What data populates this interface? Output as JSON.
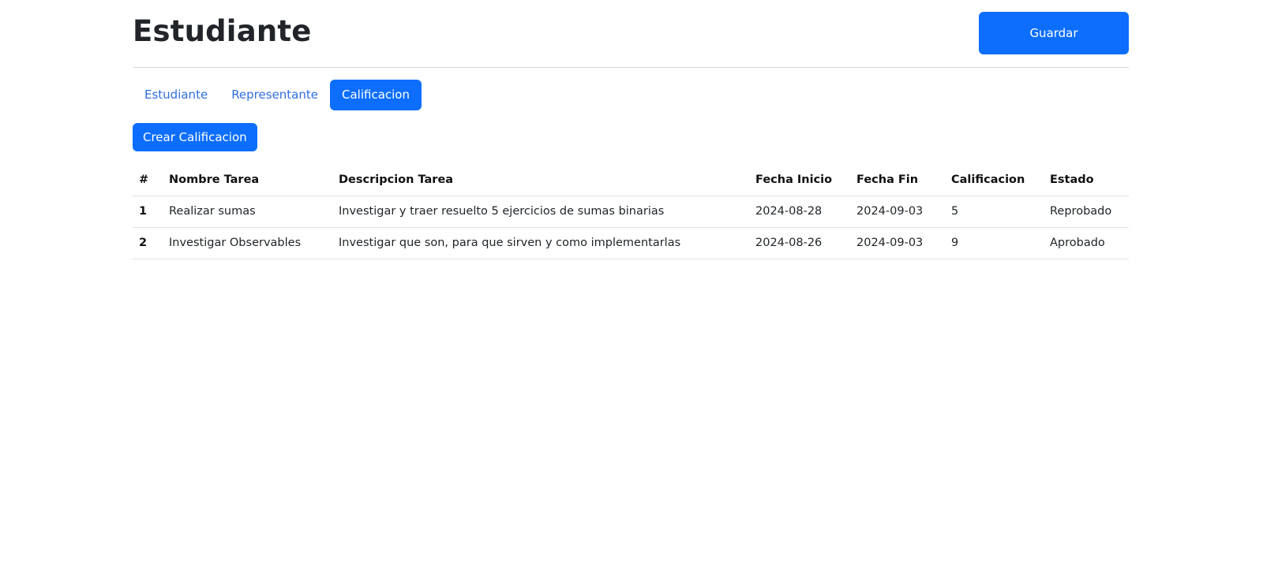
{
  "header": {
    "title": "Estudiante",
    "save_label": "Guardar"
  },
  "tabs": [
    {
      "label": "Estudiante",
      "active": false
    },
    {
      "label": "Representante",
      "active": false
    },
    {
      "label": "Calificacion",
      "active": true
    }
  ],
  "actions": {
    "create_label": "Crear Calificacion"
  },
  "table": {
    "columns": [
      "#",
      "Nombre Tarea",
      "Descripcion Tarea",
      "Fecha Inicio",
      "Fecha Fin",
      "Calificacion",
      "Estado"
    ],
    "rows": [
      [
        "1",
        "Realizar sumas",
        "Investigar y traer resuelto 5 ejercicios de sumas binarias",
        "2024-08-28",
        "2024-09-03",
        "5",
        "Reprobado"
      ],
      [
        "2",
        "Investigar Observables",
        "Investigar que son, para que sirven y como implementarlas",
        "2024-08-26",
        "2024-09-03",
        "9",
        "Aprobado"
      ]
    ]
  },
  "colors": {
    "primary": "#0d6efd",
    "link": "#2f6fe0"
  }
}
